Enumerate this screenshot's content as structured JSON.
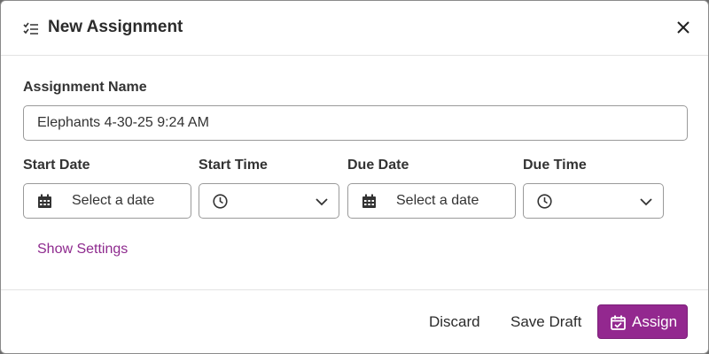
{
  "dialog": {
    "title": "New Assignment",
    "title_icon": "checklist-icon",
    "close_icon": "close-icon"
  },
  "form": {
    "name_label": "Assignment Name",
    "name_value": "Elephants 4-30-25 9:24 AM",
    "start_date": {
      "label": "Start Date",
      "placeholder": "Select a date",
      "icon": "calendar-icon"
    },
    "start_time": {
      "label": "Start Time",
      "value": "",
      "icon": "clock-icon"
    },
    "due_date": {
      "label": "Due Date",
      "placeholder": "Select a date",
      "icon": "calendar-icon"
    },
    "due_time": {
      "label": "Due Time",
      "value": "",
      "icon": "clock-icon"
    },
    "show_settings": "Show Settings"
  },
  "footer": {
    "discard": "Discard",
    "save_draft": "Save Draft",
    "assign": "Assign",
    "assign_icon": "calendar-check-icon"
  },
  "colors": {
    "accent": "#93288f",
    "link": "#8e2a8e"
  }
}
